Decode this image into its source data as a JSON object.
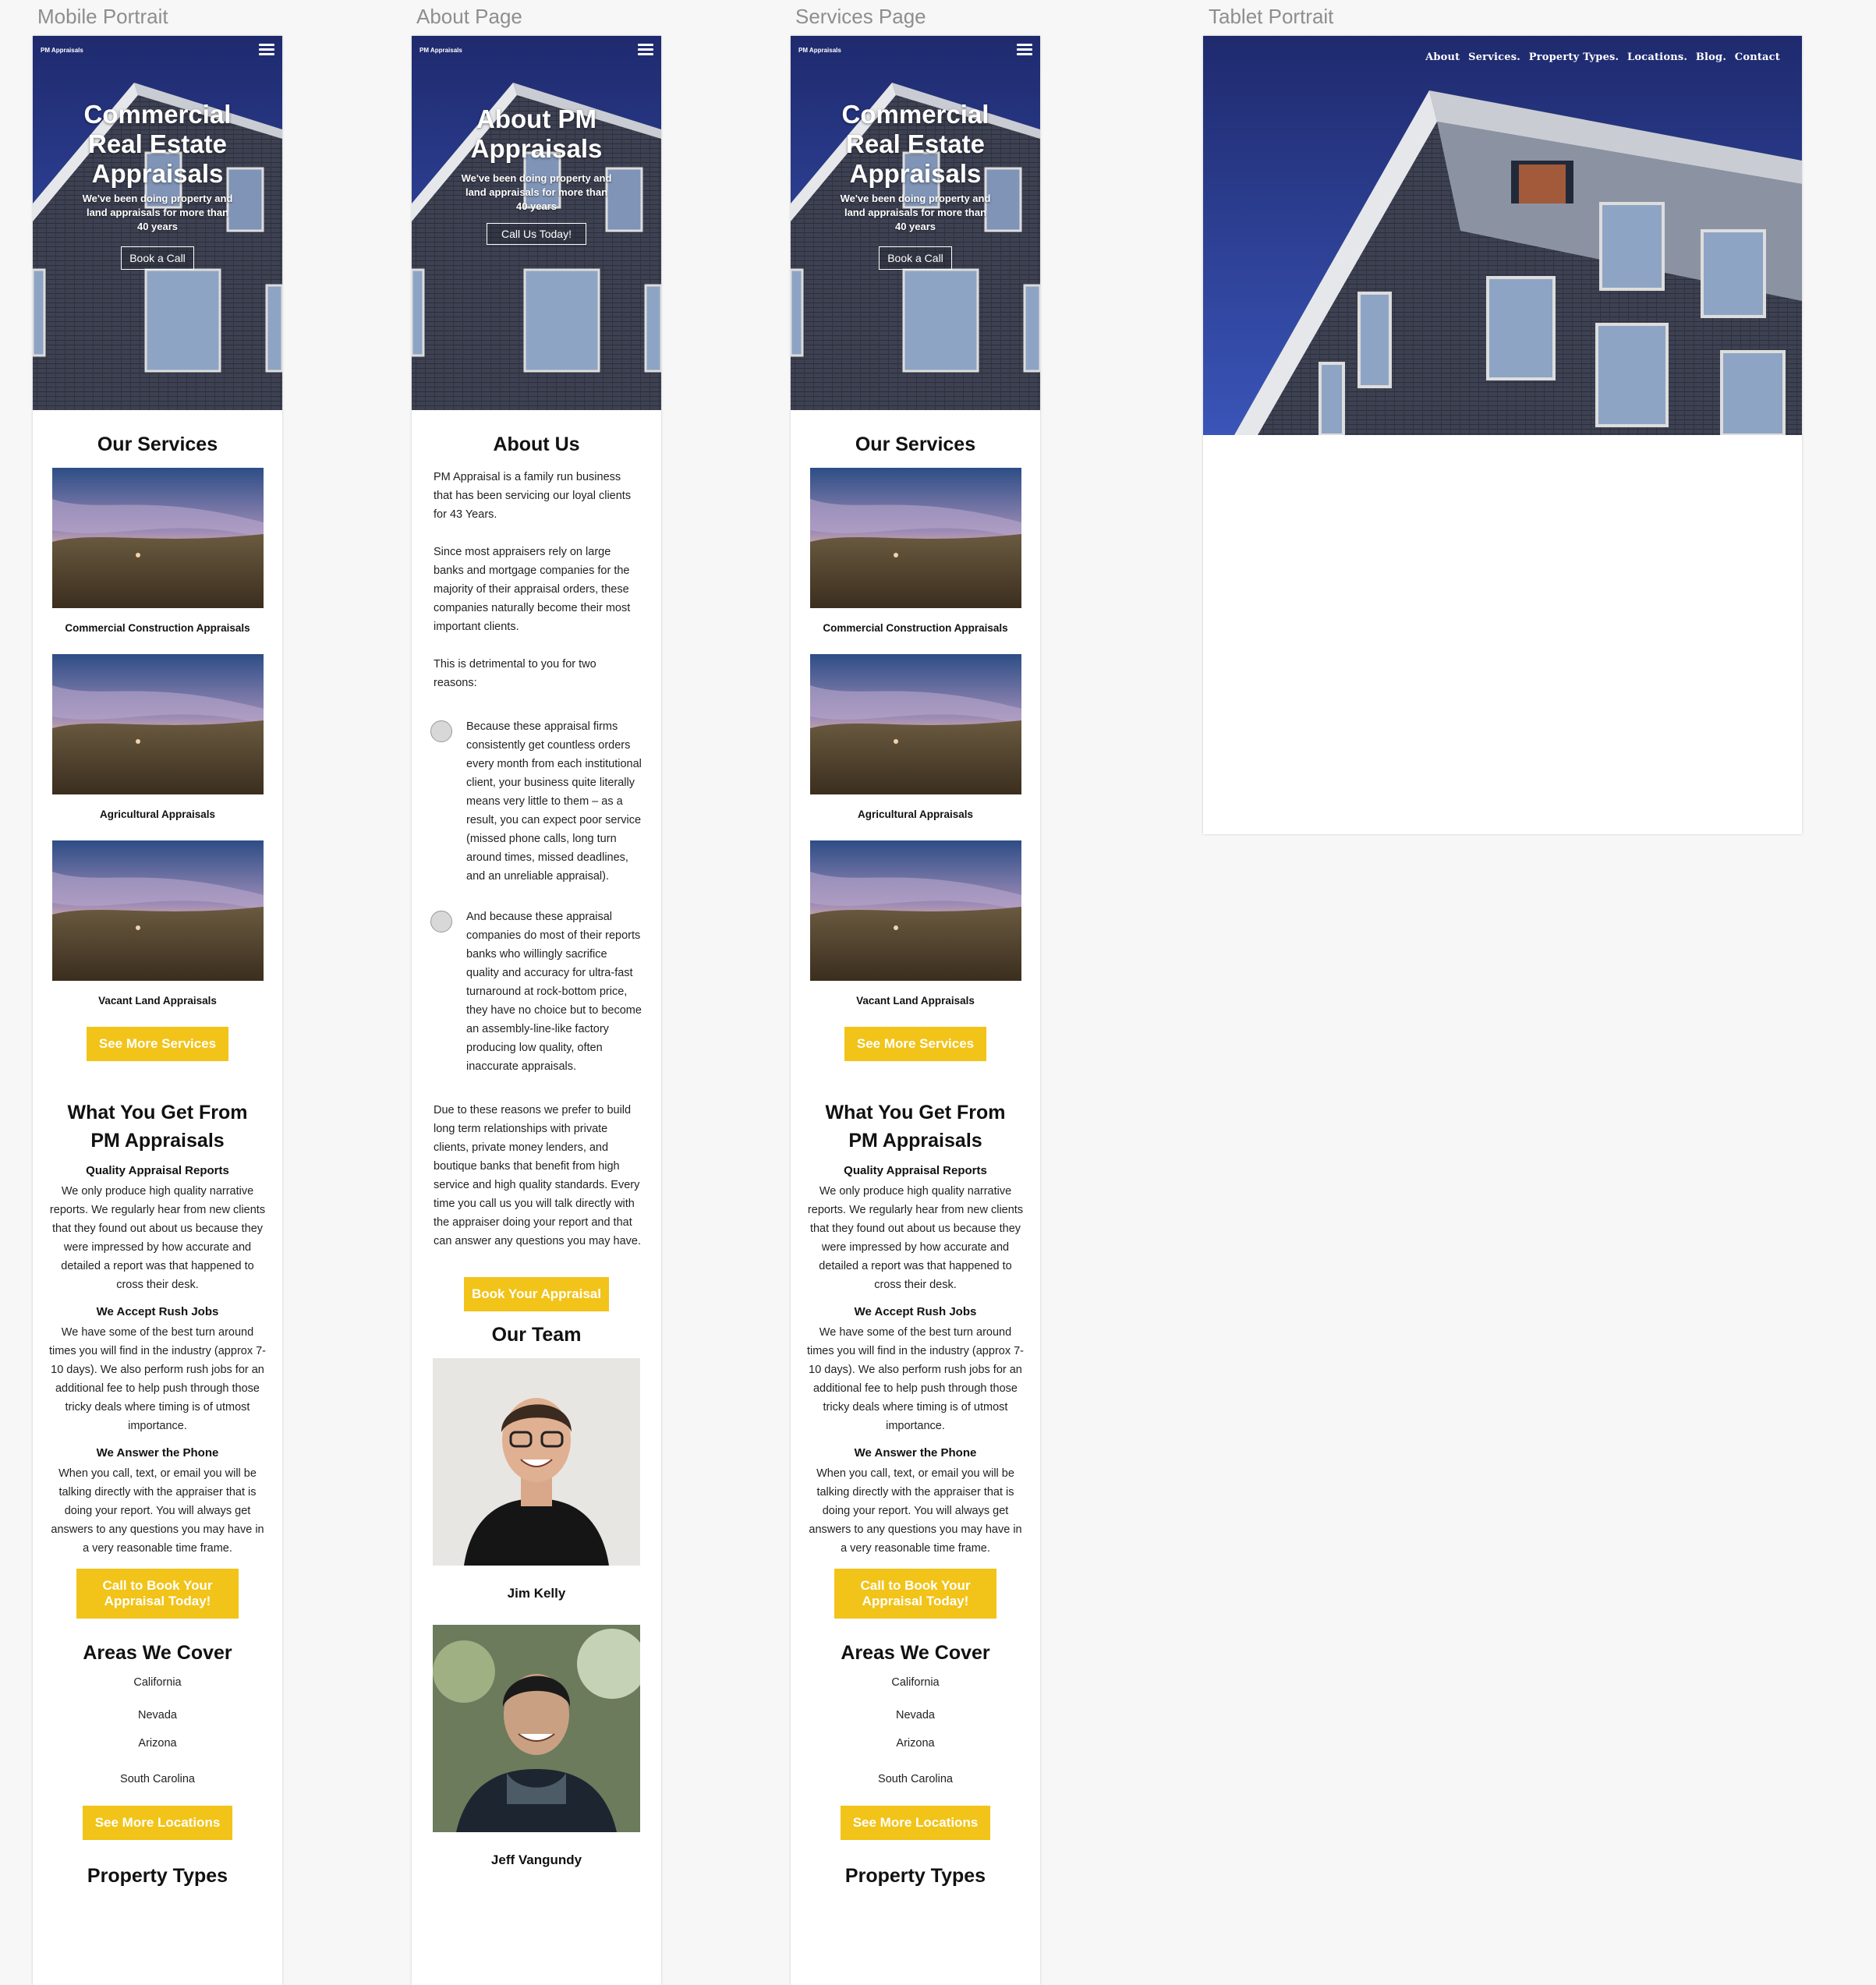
{
  "artboards": {
    "mobile_label": "Mobile Portrait",
    "about_label": "About Page",
    "services_label": "Services Page",
    "tablet_label": "Tablet Portrait"
  },
  "brand": "PM Appraisals",
  "icons": {
    "menu": "hamburger-menu-icon",
    "bullet": "circle-bullet-icon"
  },
  "colors": {
    "accent": "#f2c318",
    "hero_sky": "#2b3a8c"
  },
  "home": {
    "hero_title": "Commercial Real Estate Appraisals",
    "hero_subtitle": "We've been doing property and land appraisals for more than 40 years",
    "hero_button": "Book a Call",
    "services_title": "Our Services",
    "services": [
      {
        "label": "Commercial Construction Appraisals"
      },
      {
        "label": "Agricultural Appraisals"
      },
      {
        "label": "Vacant Land Appraisals"
      }
    ],
    "see_more_services": "See More Services",
    "benefits_title": "What You Get From PM Appraisals",
    "features": [
      {
        "title": "Quality Appraisal Reports",
        "text": "We only produce high quality narrative reports. We regularly hear from new clients that they found out about us because they were impressed by how accurate and detailed a report was that happened to cross their desk."
      },
      {
        "title": "We Accept Rush Jobs",
        "text": "We have some of the best turn around times you will find in the industry (approx 7-10 days). We also perform rush jobs for an additional fee to help push through those tricky deals where timing is of utmost importance."
      },
      {
        "title": "We Answer the Phone",
        "text": "When you call, text, or email you will be talking directly with the appraiser that is doing your report. You will always get answers to any questions you may have in a very reasonable time frame."
      }
    ],
    "call_button": "Call to Book Your Appraisal Today!",
    "areas_title": "Areas We Cover",
    "areas": [
      "California",
      "Nevada",
      "Arizona",
      "South Carolina"
    ],
    "see_more_locations": "See More Locations",
    "property_types_title": "Property Types"
  },
  "about": {
    "hero_title": "About PM Appraisals",
    "hero_subtitle": "We've been doing property and land appraisals for more than 40 years",
    "hero_button": "Call Us Today!",
    "title": "About Us",
    "p1": "PM Appraisal is a family run business that has been servicing our loyal clients for 43 Years.",
    "p2": "Since most appraisers rely on large banks and mortgage companies for the majority of their appraisal orders, these companies naturally become their most important clients.",
    "p3": "This is detrimental to you for two reasons:",
    "bullets": [
      "Because these appraisal firms consistently get countless orders every month from each institutional client, your business quite literally means very little to them – as a result, you can expect poor service (missed phone calls, long turn around times, missed deadlines, and an unreliable appraisal).",
      "And because these appraisal companies do most of their reports banks who willingly sacrifice quality and accuracy for ultra-fast turnaround at rock-bottom price, they have no choice but to become an assembly-line-like factory producing low quality, often inaccurate appraisals."
    ],
    "p4": "Due to these reasons we prefer to build long term relationships with private clients, private money lenders, and boutique banks that benefit from high service and high quality standards. Every time you call us you will talk directly with the appraiser doing your report and that can answer any questions you may have.",
    "book_button": "Book Your Appraisal",
    "team_title": "Our Team",
    "team": [
      {
        "name": "Jim Kelly"
      },
      {
        "name": "Jeff Vangundy"
      }
    ]
  },
  "tablet": {
    "nav": [
      "About",
      "Services.",
      "Property Types.",
      "Locations.",
      "Blog.",
      "Contact"
    ]
  }
}
